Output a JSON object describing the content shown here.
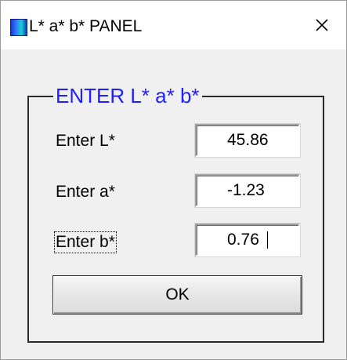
{
  "window": {
    "title": "L* a* b* PANEL",
    "icon": "app-icon",
    "close_glyph": "✕"
  },
  "group": {
    "title": "ENTER L* a* b*",
    "title_color": "#1f1fff"
  },
  "fields": [
    {
      "label": "Enter L*",
      "value": "45.86"
    },
    {
      "label": "Enter a*",
      "value": "-1.23"
    },
    {
      "label": "Enter b*",
      "value": "0.76"
    }
  ],
  "ok_button": {
    "label": "OK"
  }
}
